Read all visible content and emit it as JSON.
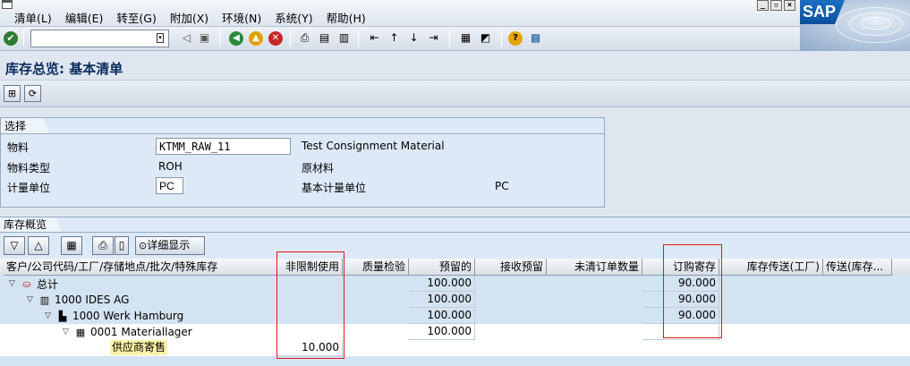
{
  "menu": {
    "items": [
      "清单(L)",
      "编辑(E)",
      "转至(G)",
      "附加(X)",
      "环境(N)",
      "系统(Y)",
      "帮助(H)"
    ]
  },
  "branding": {
    "logo": "SAP"
  },
  "toolbar": {
    "command_value": ""
  },
  "page": {
    "title": "库存总览: 基本清单"
  },
  "selection": {
    "header": "选择",
    "material_label": "物料",
    "material_value": "KTMM_RAW_11",
    "material_desc": "Test Consignment Material",
    "material_type_label": "物料类型",
    "material_type_value": "ROH",
    "material_type_desc": "原材料",
    "uom_label": "计量单位",
    "uom_value": "PC",
    "base_uom_label": "基本计量单位",
    "base_uom_value": "PC"
  },
  "stock": {
    "header": "库存概览",
    "detail_button": "详细显示",
    "columns": [
      "客户/公司代码/工厂/存储地点/批次/特殊库存",
      "非限制使用",
      "质量检验",
      "预留的",
      "接收预留",
      "未清订单数量",
      "订购寄存",
      "库存传送(工厂)",
      "传送(库存..."
    ],
    "rows": [
      {
        "label": "总计",
        "reserved": "100.000",
        "consignment_order": "90.000"
      },
      {
        "label": "1000 IDES AG",
        "reserved": "100.000",
        "consignment_order": "90.000"
      },
      {
        "label": "1000 Werk Hamburg",
        "reserved": "100.000",
        "consignment_order": "90.000"
      },
      {
        "label": "0001 Materiallager",
        "reserved": "100.000",
        "consignment_order": ""
      },
      {
        "label": "供应商寄售",
        "unrestricted": "10.000"
      }
    ]
  },
  "colors": {
    "accent_red": "#e0181b",
    "row_blue": "#d4e3f1",
    "highlight_yellow": "#fdf3a8"
  }
}
